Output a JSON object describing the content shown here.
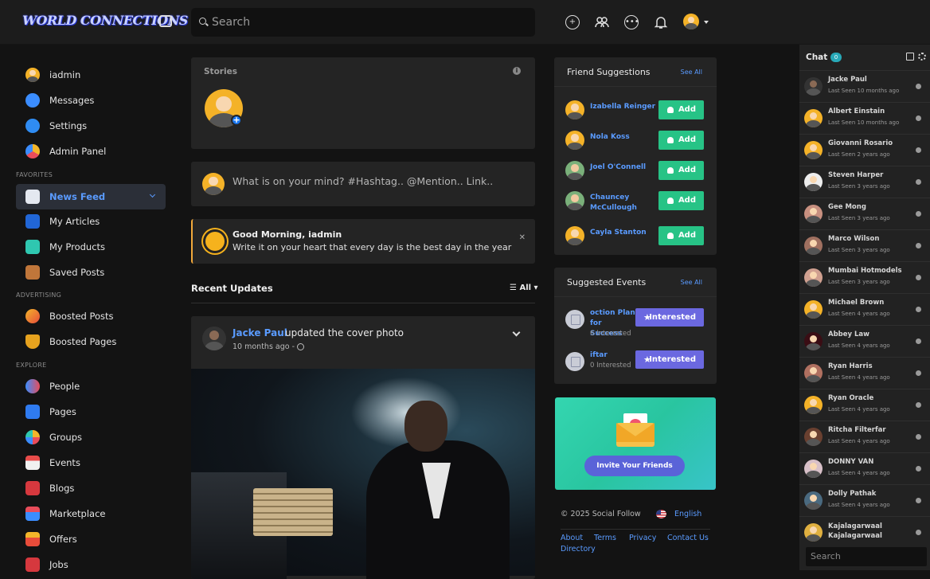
{
  "topbar": {
    "logo": "WORLD CONNECTIONS",
    "search_placeholder": "Search"
  },
  "sidebar": {
    "items": [
      {
        "label": "iadmin",
        "icon": "user-avatar-icon"
      },
      {
        "label": "Messages",
        "icon": "messages-icon"
      },
      {
        "label": "Settings",
        "icon": "gear-icon"
      },
      {
        "label": "Admin Panel",
        "icon": "dashboard-icon"
      }
    ],
    "favorites_heading": "FAVORITES",
    "favorites": [
      {
        "label": "News Feed",
        "icon": "news-feed-icon"
      },
      {
        "label": "My Articles",
        "icon": "book-icon"
      },
      {
        "label": "My Products",
        "icon": "shopping-bag-icon"
      },
      {
        "label": "Saved Posts",
        "icon": "bookmark-icon"
      }
    ],
    "advertising_heading": "ADVERTISING",
    "advertising": [
      {
        "label": "Boosted Posts",
        "icon": "rocket-icon"
      },
      {
        "label": "Boosted Pages",
        "icon": "trophy-icon"
      }
    ],
    "explore_heading": "EXPLORE",
    "explore": [
      {
        "label": "People",
        "icon": "people-icon"
      },
      {
        "label": "Pages",
        "icon": "flag-icon"
      },
      {
        "label": "Groups",
        "icon": "groups-icon"
      },
      {
        "label": "Events",
        "icon": "calendar-icon"
      },
      {
        "label": "Blogs",
        "icon": "blog-icon"
      },
      {
        "label": "Marketplace",
        "icon": "marketplace-icon"
      },
      {
        "label": "Offers",
        "icon": "offers-icon"
      },
      {
        "label": "Jobs",
        "icon": "briefcase-icon"
      }
    ]
  },
  "stories": {
    "title": "Stories"
  },
  "composer": {
    "placeholder": "What is on your mind? #Hashtag.. @Mention.. Link.."
  },
  "greeting": {
    "title": "Good Morning, iadmin",
    "message": "Write it on your heart that every day is the best day in the year"
  },
  "feed": {
    "heading": "Recent Updates",
    "filter": "All",
    "post": {
      "author": "Jacke Paul",
      "action": "updated the cover photo",
      "time": "10 months ago -"
    }
  },
  "suggestions": {
    "title": "Friend Suggestions",
    "see_all": "See All",
    "add_label": "Add",
    "people": [
      "Izabella Reinger",
      "Nola Koss",
      "Joel O'Connell",
      "Chauncey McCullough",
      "Cayla Stanton"
    ]
  },
  "events": {
    "title": "Suggested Events",
    "see_all": "See All",
    "button_label": "Interested",
    "items": [
      {
        "name": "oction Plan for Success",
        "count": "6 Interested"
      },
      {
        "name": "iftar",
        "count": "0 Interested"
      }
    ]
  },
  "invite": {
    "button": "Invite Your Friends"
  },
  "footer": {
    "copyright": "© 2025 Social Follow",
    "language": "English",
    "links": [
      "About",
      "Terms",
      "Privacy",
      "Contact Us",
      "Directory"
    ]
  },
  "chat": {
    "title": "Chat",
    "count": "0",
    "search_placeholder": "Search",
    "contacts": [
      {
        "name": "Jacke Paul",
        "seen": "Last Seen 10 months ago"
      },
      {
        "name": "Albert Einstain",
        "seen": "Last Seen 10 months ago"
      },
      {
        "name": "Giovanni Rosario",
        "seen": "Last Seen 2 years ago"
      },
      {
        "name": "Steven Harper",
        "seen": "Last Seen 3 years ago"
      },
      {
        "name": "Gee Mong",
        "seen": "Last Seen 3 years ago"
      },
      {
        "name": "Marco Wilson",
        "seen": "Last Seen 3 years ago"
      },
      {
        "name": "Mumbai Hotmodels",
        "seen": "Last Seen 3 years ago"
      },
      {
        "name": "Michael Brown",
        "seen": "Last Seen 4 years ago"
      },
      {
        "name": "Abbey Law",
        "seen": "Last Seen 4 years ago"
      },
      {
        "name": "Ryan Harris",
        "seen": "Last Seen 4 years ago"
      },
      {
        "name": "Ryan Oracle",
        "seen": "Last Seen 4 years ago"
      },
      {
        "name": "Ritcha Filterfar",
        "seen": "Last Seen 4 years ago"
      },
      {
        "name": "DONNY VAN",
        "seen": "Last Seen 4 years ago"
      },
      {
        "name": "Dolly Pathak",
        "seen": "Last Seen 4 years ago"
      },
      {
        "name": "Kajalagarwaal Kajalagarwaal",
        "seen": ""
      }
    ]
  },
  "colors": {
    "accent_blue": "#5a9bff",
    "add_green": "#27c386",
    "interested_purple": "#6b68e0",
    "greeting_border": "#f2a93b",
    "background": "#131313",
    "card": "#242424"
  }
}
